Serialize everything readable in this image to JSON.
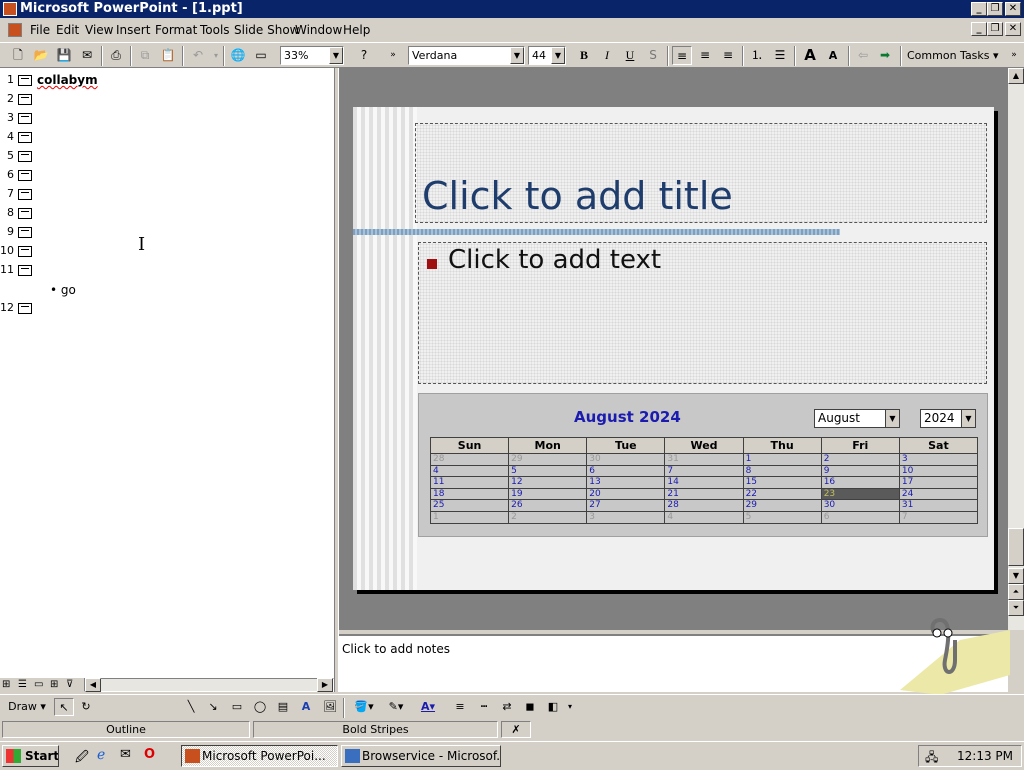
{
  "window": {
    "title": "Microsoft PowerPoint - [1.ppt]"
  },
  "menu": [
    "File",
    "Edit",
    "View",
    "Insert",
    "Format",
    "Tools",
    "Slide Show",
    "Window",
    "Help"
  ],
  "toolbar": {
    "zoom": "33%",
    "font": "Verdana",
    "font_size": "44",
    "bold": "B",
    "italic": "I",
    "underline": "U",
    "shadow": "S",
    "common_tasks": "Common Tasks"
  },
  "outline": {
    "slides": [
      {
        "num": "1",
        "text": "collabym"
      },
      {
        "num": "2",
        "text": ""
      },
      {
        "num": "3",
        "text": ""
      },
      {
        "num": "4",
        "text": ""
      },
      {
        "num": "5",
        "text": ""
      },
      {
        "num": "6",
        "text": ""
      },
      {
        "num": "7",
        "text": ""
      },
      {
        "num": "8",
        "text": ""
      },
      {
        "num": "9",
        "text": ""
      },
      {
        "num": "10",
        "text": ""
      },
      {
        "num": "11",
        "text": ""
      },
      {
        "num": "12",
        "text": ""
      }
    ],
    "bullet": "go"
  },
  "slide": {
    "title_placeholder": "Click to add title",
    "body_placeholder": "Click to add text"
  },
  "calendar": {
    "heading": "August 2024",
    "month_select": "August",
    "year_select": "2024",
    "days": [
      "Sun",
      "Mon",
      "Tue",
      "Wed",
      "Thu",
      "Fri",
      "Sat"
    ],
    "weeks": [
      [
        "28",
        "29",
        "30",
        "31",
        "1",
        "2",
        "3"
      ],
      [
        "4",
        "5",
        "6",
        "7",
        "8",
        "9",
        "10"
      ],
      [
        "11",
        "12",
        "13",
        "14",
        "15",
        "16",
        "17"
      ],
      [
        "18",
        "19",
        "20",
        "21",
        "22",
        "23",
        "24"
      ],
      [
        "25",
        "26",
        "27",
        "28",
        "29",
        "30",
        "31"
      ],
      [
        "1",
        "2",
        "3",
        "4",
        "5",
        "6",
        "7"
      ]
    ],
    "selected": "23"
  },
  "notes": {
    "placeholder": "Click to add notes"
  },
  "drawbar": {
    "draw": "Draw"
  },
  "status": {
    "view": "Outline",
    "design": "Bold Stripes"
  },
  "taskbar": {
    "start": "Start",
    "tasks": [
      "Microsoft PowerPoi...",
      "Browservice - Microsof..."
    ],
    "clock": "12:13 PM"
  }
}
